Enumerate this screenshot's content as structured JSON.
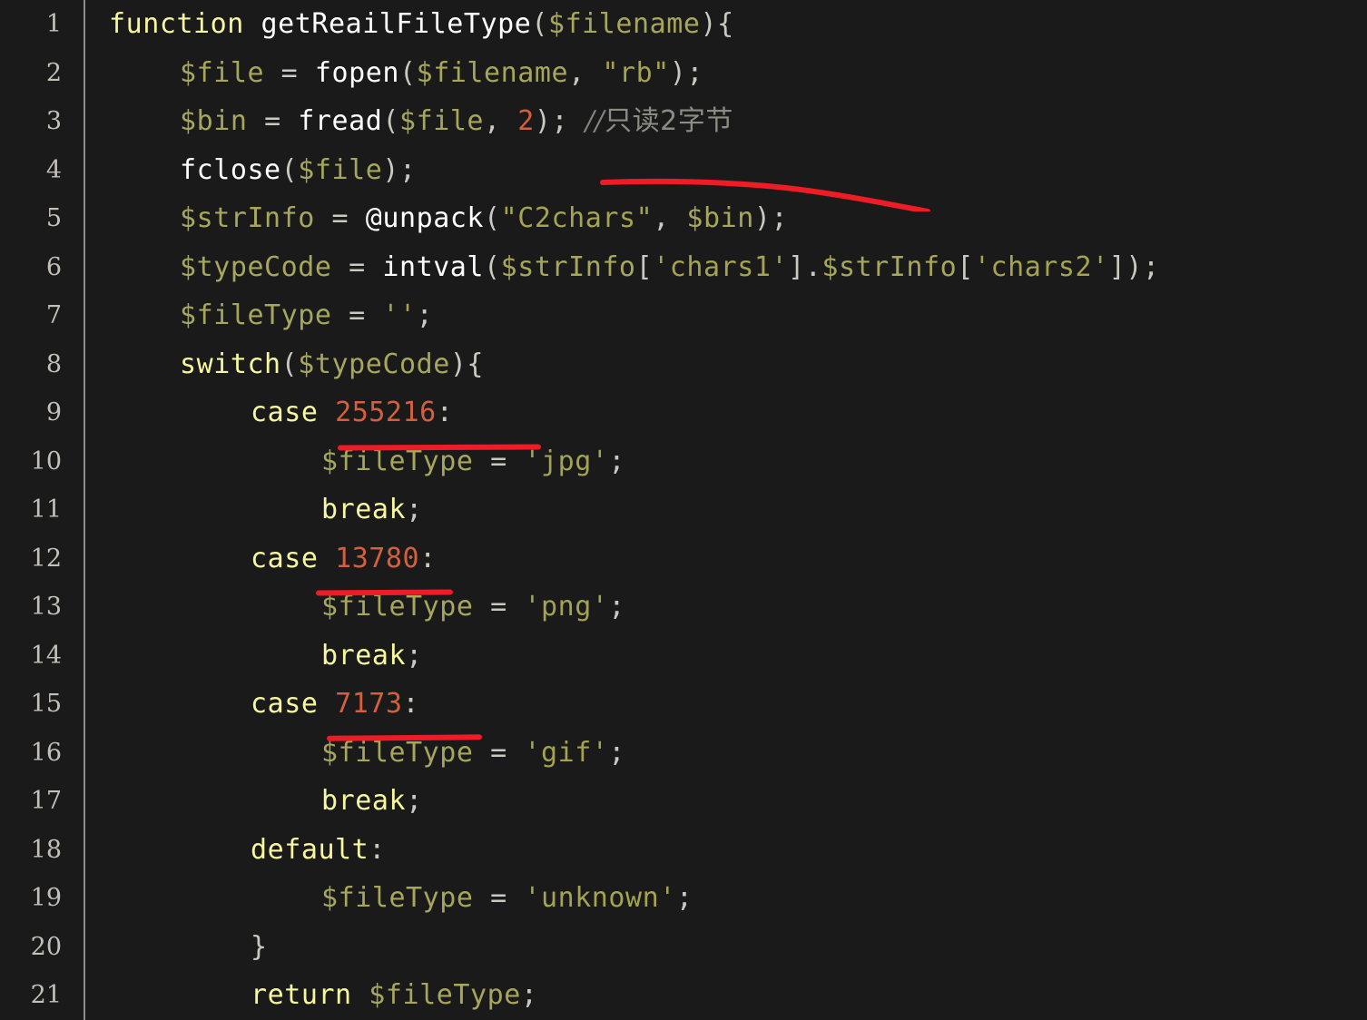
{
  "editor": {
    "language": "php",
    "theme": "dark",
    "background_color": "#1a1a1a",
    "gutter_separator_color": "#8d8d8a",
    "line_number_color": "#c2c0b8",
    "first_visible_line": 1,
    "last_visible_line": 21,
    "annotation_color": "#ee1c24"
  },
  "line_numbers": [
    "1",
    "2",
    "3",
    "4",
    "5",
    "6",
    "7",
    "8",
    "9",
    "10",
    "11",
    "12",
    "13",
    "14",
    "15",
    "16",
    "17",
    "18",
    "19",
    "20",
    "21"
  ],
  "code_lines": [
    {
      "number": "1",
      "indent": 0,
      "text": "function getReailFileType($filename){"
    },
    {
      "number": "2",
      "indent": 1,
      "text": "$file = fopen($filename, \"rb\");"
    },
    {
      "number": "3",
      "indent": 1,
      "text": "$bin = fread($file, 2); //只读2字节"
    },
    {
      "number": "4",
      "indent": 1,
      "text": "fclose($file);"
    },
    {
      "number": "5",
      "indent": 1,
      "text": "$strInfo = @unpack(\"C2chars\", $bin);"
    },
    {
      "number": "6",
      "indent": 1,
      "text": "$typeCode = intval($strInfo['chars1'].$strInfo['chars2']);"
    },
    {
      "number": "7",
      "indent": 1,
      "text": "$fileType = '';"
    },
    {
      "number": "8",
      "indent": 1,
      "text": "switch($typeCode){"
    },
    {
      "number": "9",
      "indent": 2,
      "text": "case 255216:"
    },
    {
      "number": "10",
      "indent": 3,
      "text": "$fileType = 'jpg';"
    },
    {
      "number": "11",
      "indent": 3,
      "text": "break;"
    },
    {
      "number": "12",
      "indent": 2,
      "text": "case 13780:"
    },
    {
      "number": "13",
      "indent": 3,
      "text": "$fileType = 'png';"
    },
    {
      "number": "14",
      "indent": 3,
      "text": "break;"
    },
    {
      "number": "15",
      "indent": 2,
      "text": "case 7173:"
    },
    {
      "number": "16",
      "indent": 3,
      "text": "$fileType = 'gif';"
    },
    {
      "number": "17",
      "indent": 3,
      "text": "break;"
    },
    {
      "number": "18",
      "indent": 2,
      "text": "default:"
    },
    {
      "number": "19",
      "indent": 3,
      "text": "$fileType = 'unknown';"
    },
    {
      "number": "20",
      "indent": 2,
      "text": "}"
    },
    {
      "number": "21",
      "indent": 2,
      "text": "return $fileType;"
    }
  ],
  "tokens": {
    "keyword_function": "function",
    "name_getReailFileType": "getReailFileType",
    "var_filename": "$filename",
    "var_file": "$file",
    "var_bin": "$bin",
    "var_strInfo": "$strInfo",
    "var_typeCode": "$typeCode",
    "var_fileType": "$fileType",
    "fn_fopen": "fopen",
    "fn_fread": "fread",
    "fn_fclose": "fclose",
    "fn_unpack": "unpack",
    "fn_intval": "intval",
    "keyword_switch": "switch",
    "keyword_case": "case",
    "keyword_break": "break",
    "keyword_default": "default",
    "keyword_return": "return",
    "str_rb": "\"rb\"",
    "str_C2chars": "\"C2chars\"",
    "str_chars1": "'chars1'",
    "str_chars2": "'chars2'",
    "str_empty": "''",
    "str_jpg": "'jpg'",
    "str_png": "'png'",
    "str_gif": "'gif'",
    "str_unknown": "'unknown'",
    "num_2": "2",
    "num_255216": "255216",
    "num_13780": "13780",
    "num_7173": "7173",
    "comment_slashes": "//",
    "comment_cjk": "只读2字节",
    "comment_full": "//只读2字节"
  },
  "annotations": [
    {
      "id": "squiggle-under-comment",
      "type": "hand-drawn-curve",
      "target": "//只读2字节",
      "color": "#ee1c24"
    },
    {
      "id": "underline-255216",
      "type": "underline",
      "target": "255216",
      "color": "#ee1c24"
    },
    {
      "id": "underline-13780",
      "type": "underline",
      "target": "13780",
      "color": "#ee1c24"
    },
    {
      "id": "underline-7173",
      "type": "underline",
      "target": "7173",
      "color": "#ee1c24"
    }
  ]
}
